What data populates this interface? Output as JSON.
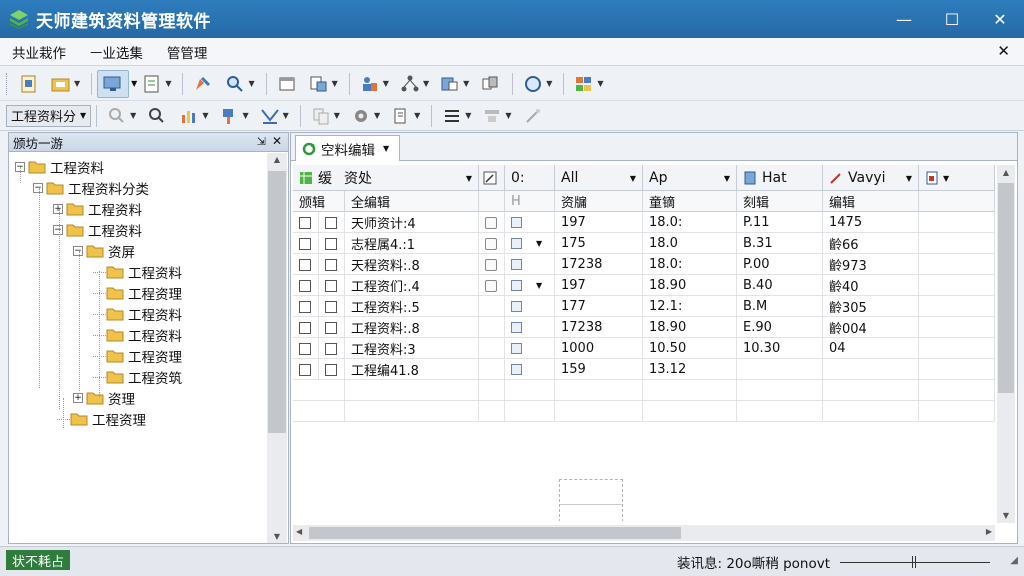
{
  "window": {
    "title": "天师建筑资料管理软件",
    "minimize_icon": "—",
    "maximize_icon": "☐",
    "close_icon": "✕"
  },
  "menu": {
    "items": [
      "共业栽作",
      "ㅡ业选集",
      "管管理"
    ],
    "close_icon": "✕"
  },
  "toolbar2": {
    "combo_label": "工程资料分"
  },
  "left_panel": {
    "title": "颁坊一游",
    "pin_icon": "⇲",
    "close_icon": "✕",
    "tree": [
      {
        "label": "工程资料",
        "expander": "−"
      },
      {
        "label": "工程资料分类",
        "expander": "−"
      },
      {
        "label": "工程资料",
        "expander": "+"
      },
      {
        "label": "工程资料",
        "expander": "−"
      },
      {
        "label": "资屏",
        "expander": "−"
      },
      {
        "label": "工程资料",
        "expander": ""
      },
      {
        "label": "工程资理",
        "expander": ""
      },
      {
        "label": "工程资料",
        "expander": ""
      },
      {
        "label": "工程资料",
        "expander": ""
      },
      {
        "label": "工程资理",
        "expander": ""
      },
      {
        "label": "工程资筑",
        "expander": ""
      },
      {
        "label": "资理",
        "expander": "+"
      },
      {
        "label": "工程资理",
        "expander": ""
      }
    ]
  },
  "right_panel": {
    "tab_label": "空料编辑",
    "header1": {
      "c1": "缓",
      "c2": "资处",
      "c3": "0:",
      "c4": "All",
      "c5": "Ap",
      "c6": "Hat",
      "c7": "Vavyi"
    },
    "header2": {
      "c1": "颁辑",
      "c2": "全编辑",
      "c3": "H",
      "c4": "资牖",
      "c5": "童镝",
      "c6": "刻辑",
      "c7": "编辑"
    },
    "rows": [
      {
        "name": "天师资计:4",
        "c4": "197",
        "c5": "18.0:",
        "c6": "P.11",
        "c7": "1475",
        "icon": true,
        "dd": false
      },
      {
        "name": "志程属4.:1",
        "c4": "175",
        "c5": "18.0",
        "c6": "B.31",
        "c7": "齡66",
        "icon": true,
        "dd": true
      },
      {
        "name": "天程资料:.8",
        "c4": "17238",
        "c5": "18.0:",
        "c6": "P.00",
        "c7": "齡973",
        "icon": true,
        "dd": false
      },
      {
        "name": "工程资们:.4",
        "c4": "197",
        "c5": "18.90",
        "c6": "B.40",
        "c7": "齡40",
        "icon": true,
        "dd": true
      },
      {
        "name": "工程资料:.5",
        "c4": "177",
        "c5": "12.1:",
        "c6": "B.M",
        "c7": "齡305",
        "icon": false,
        "dd": false
      },
      {
        "name": "工程资料:.8",
        "c4": "17238",
        "c5": "18.90",
        "c6": "E.90",
        "c7": "齡004",
        "icon": false,
        "dd": false
      },
      {
        "name": "工程资料:3",
        "c4": "1000",
        "c5": "10.50",
        "c6": "10.30",
        "c7": "04",
        "icon": false,
        "dd": false
      },
      {
        "name": "工程编41.8",
        "c4": "159",
        "c5": "13.12",
        "c6": "",
        "c7": "",
        "icon": false,
        "dd": false
      }
    ]
  },
  "status": {
    "left": "状不耗占",
    "right": "装讯息: 20o嘶稍 ponovt"
  },
  "colors": {
    "titlebar": "#2569a6",
    "status_badge": "#2f7d3c",
    "folder": "#f1c24a"
  }
}
